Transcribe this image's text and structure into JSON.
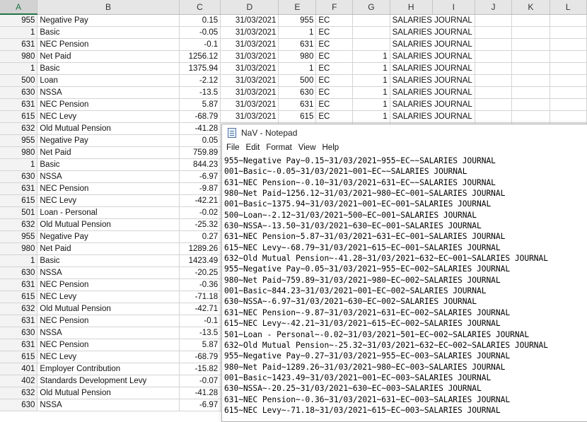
{
  "spreadsheet": {
    "columns": [
      "A",
      "B",
      "C",
      "D",
      "E",
      "F",
      "G",
      "H",
      "I",
      "J",
      "K",
      "L"
    ],
    "selected_column": "A",
    "rows": [
      {
        "a": "955",
        "b": "Negative Pay",
        "c": "0.15",
        "d": "31/03/2021",
        "e": "955",
        "f": "EC",
        "g": "",
        "h": "SALARIES JOURNAL"
      },
      {
        "a": "1",
        "b": "Basic",
        "c": "-0.05",
        "d": "31/03/2021",
        "e": "1",
        "f": "EC",
        "g": "",
        "h": "SALARIES JOURNAL"
      },
      {
        "a": "631",
        "b": "NEC Pension",
        "c": "-0.1",
        "d": "31/03/2021",
        "e": "631",
        "f": "EC",
        "g": "",
        "h": "SALARIES JOURNAL"
      },
      {
        "a": "980",
        "b": "Net Paid",
        "c": "1256.12",
        "d": "31/03/2021",
        "e": "980",
        "f": "EC",
        "g": "1",
        "h": "SALARIES JOURNAL"
      },
      {
        "a": "1",
        "b": "Basic",
        "c": "1375.94",
        "d": "31/03/2021",
        "e": "1",
        "f": "EC",
        "g": "1",
        "h": "SALARIES JOURNAL"
      },
      {
        "a": "500",
        "b": "Loan",
        "c": "-2.12",
        "d": "31/03/2021",
        "e": "500",
        "f": "EC",
        "g": "1",
        "h": "SALARIES JOURNAL"
      },
      {
        "a": "630",
        "b": "NSSA",
        "c": "-13.5",
        "d": "31/03/2021",
        "e": "630",
        "f": "EC",
        "g": "1",
        "h": "SALARIES JOURNAL"
      },
      {
        "a": "631",
        "b": "NEC Pension",
        "c": "5.87",
        "d": "31/03/2021",
        "e": "631",
        "f": "EC",
        "g": "1",
        "h": "SALARIES JOURNAL"
      },
      {
        "a": "615",
        "b": "NEC Levy",
        "c": "-68.79",
        "d": "31/03/2021",
        "e": "615",
        "f": "EC",
        "g": "1",
        "h": "SALARIES JOURNAL"
      },
      {
        "a": "632",
        "b": "Old Mutual Pension",
        "c": "-41.28"
      },
      {
        "a": "955",
        "b": "Negative Pay",
        "c": "0.05"
      },
      {
        "a": "980",
        "b": "Net Paid",
        "c": "759.89"
      },
      {
        "a": "1",
        "b": "Basic",
        "c": "844.23"
      },
      {
        "a": "630",
        "b": "NSSA",
        "c": "-6.97"
      },
      {
        "a": "631",
        "b": "NEC Pension",
        "c": "-9.87"
      },
      {
        "a": "615",
        "b": "NEC Levy",
        "c": "-42.21"
      },
      {
        "a": "501",
        "b": "Loan - Personal",
        "c": "-0.02"
      },
      {
        "a": "632",
        "b": "Old Mutual Pension",
        "c": "-25.32"
      },
      {
        "a": "955",
        "b": "Negative Pay",
        "c": "0.27"
      },
      {
        "a": "980",
        "b": "Net Paid",
        "c": "1289.26"
      },
      {
        "a": "1",
        "b": "Basic",
        "c": "1423.49"
      },
      {
        "a": "630",
        "b": "NSSA",
        "c": "-20.25"
      },
      {
        "a": "631",
        "b": "NEC Pension",
        "c": "-0.36"
      },
      {
        "a": "615",
        "b": "NEC Levy",
        "c": "-71.18"
      },
      {
        "a": "632",
        "b": "Old Mutual Pension",
        "c": "-42.71"
      },
      {
        "a": "631",
        "b": "NEC Pension",
        "c": "-0.1"
      },
      {
        "a": "630",
        "b": "NSSA",
        "c": "-13.5"
      },
      {
        "a": "631",
        "b": "NEC Pension",
        "c": "5.87"
      },
      {
        "a": "615",
        "b": "NEC Levy",
        "c": "-68.79"
      },
      {
        "a": "401",
        "b": "Employer Contribution",
        "c": "-15.82"
      },
      {
        "a": "402",
        "b": "Standards Development Levy",
        "c": "-0.07"
      },
      {
        "a": "632",
        "b": "Old Mutual Pension",
        "c": "-41.28"
      },
      {
        "a": "630",
        "b": "NSSA",
        "c": "-6.97"
      }
    ]
  },
  "notepad": {
    "title": "NaV - Notepad",
    "menu": [
      "File",
      "Edit",
      "Format",
      "View",
      "Help"
    ],
    "lines": [
      "955~Negative Pay~0.15~31/03/2021~955~EC~~SALARIES JOURNAL",
      "001~Basic~-0.05~31/03/2021~001~EC~~SALARIES JOURNAL",
      "631~NEC Pension~-0.10~31/03/2021~631~EC~~SALARIES JOURNAL",
      "980~Net Paid~1256.12~31/03/2021~980~EC~001~SALARIES JOURNAL",
      "001~Basic~1375.94~31/03/2021~001~EC~001~SALARIES JOURNAL",
      "500~Loan~-2.12~31/03/2021~500~EC~001~SALARIES JOURNAL",
      "630~NSSA~-13.50~31/03/2021~630~EC~001~SALARIES JOURNAL",
      "631~NEC Pension~5.87~31/03/2021~631~EC~001~SALARIES JOURNAL",
      "615~NEC Levy~-68.79~31/03/2021~615~EC~001~SALARIES JOURNAL",
      "632~Old Mutual Pension~-41.28~31/03/2021~632~EC~001~SALARIES JOURNAL",
      "955~Negative Pay~0.05~31/03/2021~955~EC~002~SALARIES JOURNAL",
      "980~Net Paid~759.89~31/03/2021~980~EC~002~SALARIES JOURNAL",
      "001~Basic~844.23~31/03/2021~001~EC~002~SALARIES JOURNAL",
      "630~NSSA~-6.97~31/03/2021~630~EC~002~SALARIES JOURNAL",
      "631~NEC Pension~-9.87~31/03/2021~631~EC~002~SALARIES JOURNAL",
      "615~NEC Levy~-42.21~31/03/2021~615~EC~002~SALARIES JOURNAL",
      "501~Loan - Personal~-0.02~31/03/2021~501~EC~002~SALARIES JOURNAL",
      "632~Old Mutual Pension~-25.32~31/03/2021~632~EC~002~SALARIES JOURNAL",
      "955~Negative Pay~0.27~31/03/2021~955~EC~003~SALARIES JOURNAL",
      "980~Net Paid~1289.26~31/03/2021~980~EC~003~SALARIES JOURNAL",
      "001~Basic~1423.49~31/03/2021~001~EC~003~SALARIES JOURNAL",
      "630~NSSA~-20.25~31/03/2021~630~EC~003~SALARIES JOURNAL",
      "631~NEC Pension~-0.36~31/03/2021~631~EC~003~SALARIES JOURNAL",
      "615~NEC Levy~-71.18~31/03/2021~615~EC~003~SALARIES JOURNAL"
    ]
  }
}
